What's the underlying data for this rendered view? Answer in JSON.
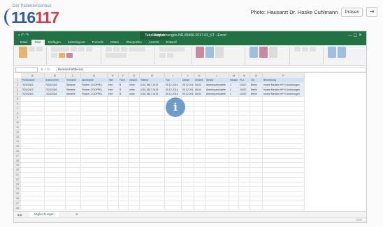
{
  "logo": {
    "tagline": "Der Patientenservice",
    "number_blue": "116",
    "number_red": "117"
  },
  "header": {
    "photo_credit": "Photo: Hausarzt Dr. Haske Cuhlmann",
    "present_label": "Präsen",
    "exit_icon": "exit-fullscreen-icon"
  },
  "excel": {
    "window_title": "Abgleichungen-NR-89456-2017-03_ST - Excel",
    "context_tab": "Tabellentools",
    "ribbon_tabs": [
      "Datei",
      "Start",
      "Einfügen",
      "Seitenlayout",
      "Formeln",
      "Daten",
      "Überprüfen",
      "Ansicht",
      "Entwurf"
    ],
    "name_box": "",
    "formula_value": "Bereitschaftdienst",
    "columns": [
      "A",
      "B",
      "C",
      "D",
      "E",
      "F",
      "G",
      "H",
      "I",
      "J",
      "K",
      "L",
      "M",
      "N",
      "O",
      "P"
    ],
    "header_row": [
      "Praxisname",
      "Arztnummer",
      "Vorname",
      "Nachname",
      "Titel",
      "Fach",
      "Geschl.",
      "Telefon",
      "Fax",
      "Datum",
      "Uhrzeit",
      "Straße",
      "Hausnr.",
      "PLZ",
      "Ort",
      "Bemerkung"
    ],
    "data_rows": [
      [
        "7024/2403",
        "7024/2403",
        "Stefanie",
        "Fischer 2 DOPPEL",
        "Herr",
        "B",
        "ohne",
        "0151 5617 2419",
        "05.12.2016",
        "05.12.2016",
        "08:00",
        "Abendsprechzeile",
        "1",
        "10407",
        "Berlin",
        "Innere Medizin HP 9 Änderungen"
      ],
      [
        "7024/2403",
        "7024/2403",
        "Stefanie",
        "Fischer 2 DOPPEL",
        "Herr",
        "B",
        "ohne",
        "0151 5617 2419",
        "05.12.2016",
        "05.12.2016",
        "08:00",
        "Abendsprechzeile",
        "1",
        "10407",
        "Berlin",
        "Innere Medizin HP 9 Änderungen"
      ],
      [
        "7024/2403",
        "7024/2403",
        "Stefanie",
        "Fischer 2 DOPPEL",
        "Herr",
        "B",
        "ohne",
        "0151 5617 2419",
        "05.12.2016",
        "05.12.2016",
        "08:00",
        "Abendsprechzeile",
        "1",
        "10407",
        "Berlin",
        "Innere Medizin HP 9 Änderungen"
      ]
    ],
    "sheet_tab": "Abgleichungen",
    "zoom": "100%"
  },
  "overlay": {
    "info_symbol": "i",
    "info_icon_name": "info-icon"
  }
}
